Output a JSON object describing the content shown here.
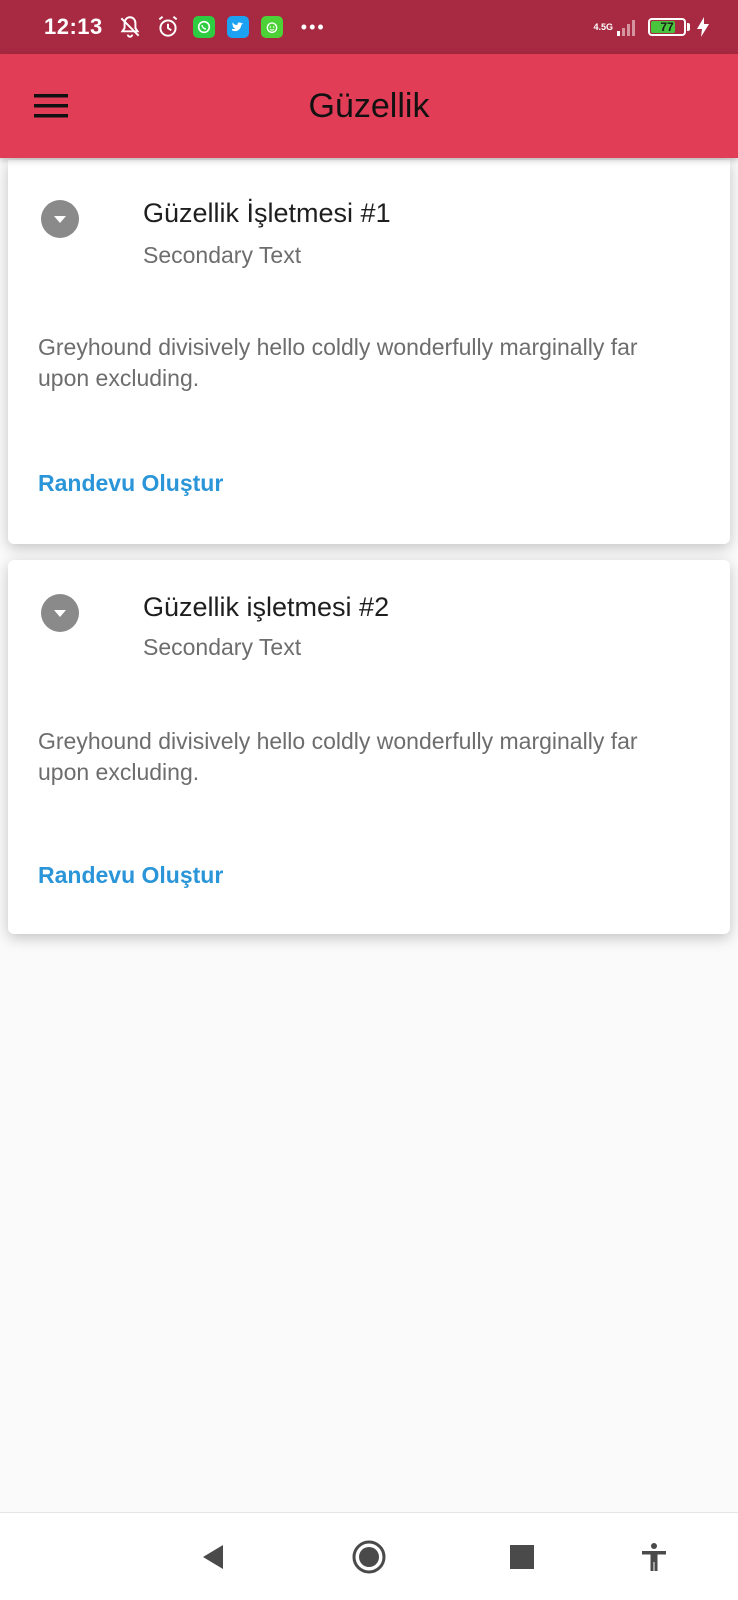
{
  "status_bar": {
    "time": "12:13",
    "network_label": "4.5G",
    "battery_level": "77",
    "battery_fraction": 0.77,
    "overflow": "•••",
    "icons": [
      "mute-bell-icon",
      "alarm-icon",
      "whatsapp-icon",
      "twitter-icon",
      "app-icon",
      "overflow-icon",
      "signal-icon",
      "battery-icon",
      "charging-icon"
    ],
    "colors": {
      "background": "#a82a42",
      "whatsapp": "#2ecc40",
      "twitter": "#1da1f2",
      "app": "#4cd137"
    }
  },
  "app_bar": {
    "title": "Güzellik",
    "menu_icon": "hamburger-menu-icon",
    "color": "#e13d56"
  },
  "cards": [
    {
      "title": "Güzellik İşletmesi #1",
      "subtitle": "Secondary Text",
      "body": "Greyhound divisively hello coldly wonderfully marginally far upon excluding.",
      "action": "Randevu Oluştur",
      "icon": "expand-more-icon"
    },
    {
      "title": "Güzellik işletmesi #2",
      "subtitle": "Secondary Text",
      "body": "Greyhound divisively hello coldly wonderfully marginally far upon excluding.",
      "action": "Randevu Oluştur",
      "icon": "expand-more-icon"
    }
  ],
  "accent_color": "#2a95d8",
  "nav_bar": {
    "icons": [
      "back-icon",
      "home-icon",
      "recents-icon",
      "accessibility-icon"
    ]
  }
}
